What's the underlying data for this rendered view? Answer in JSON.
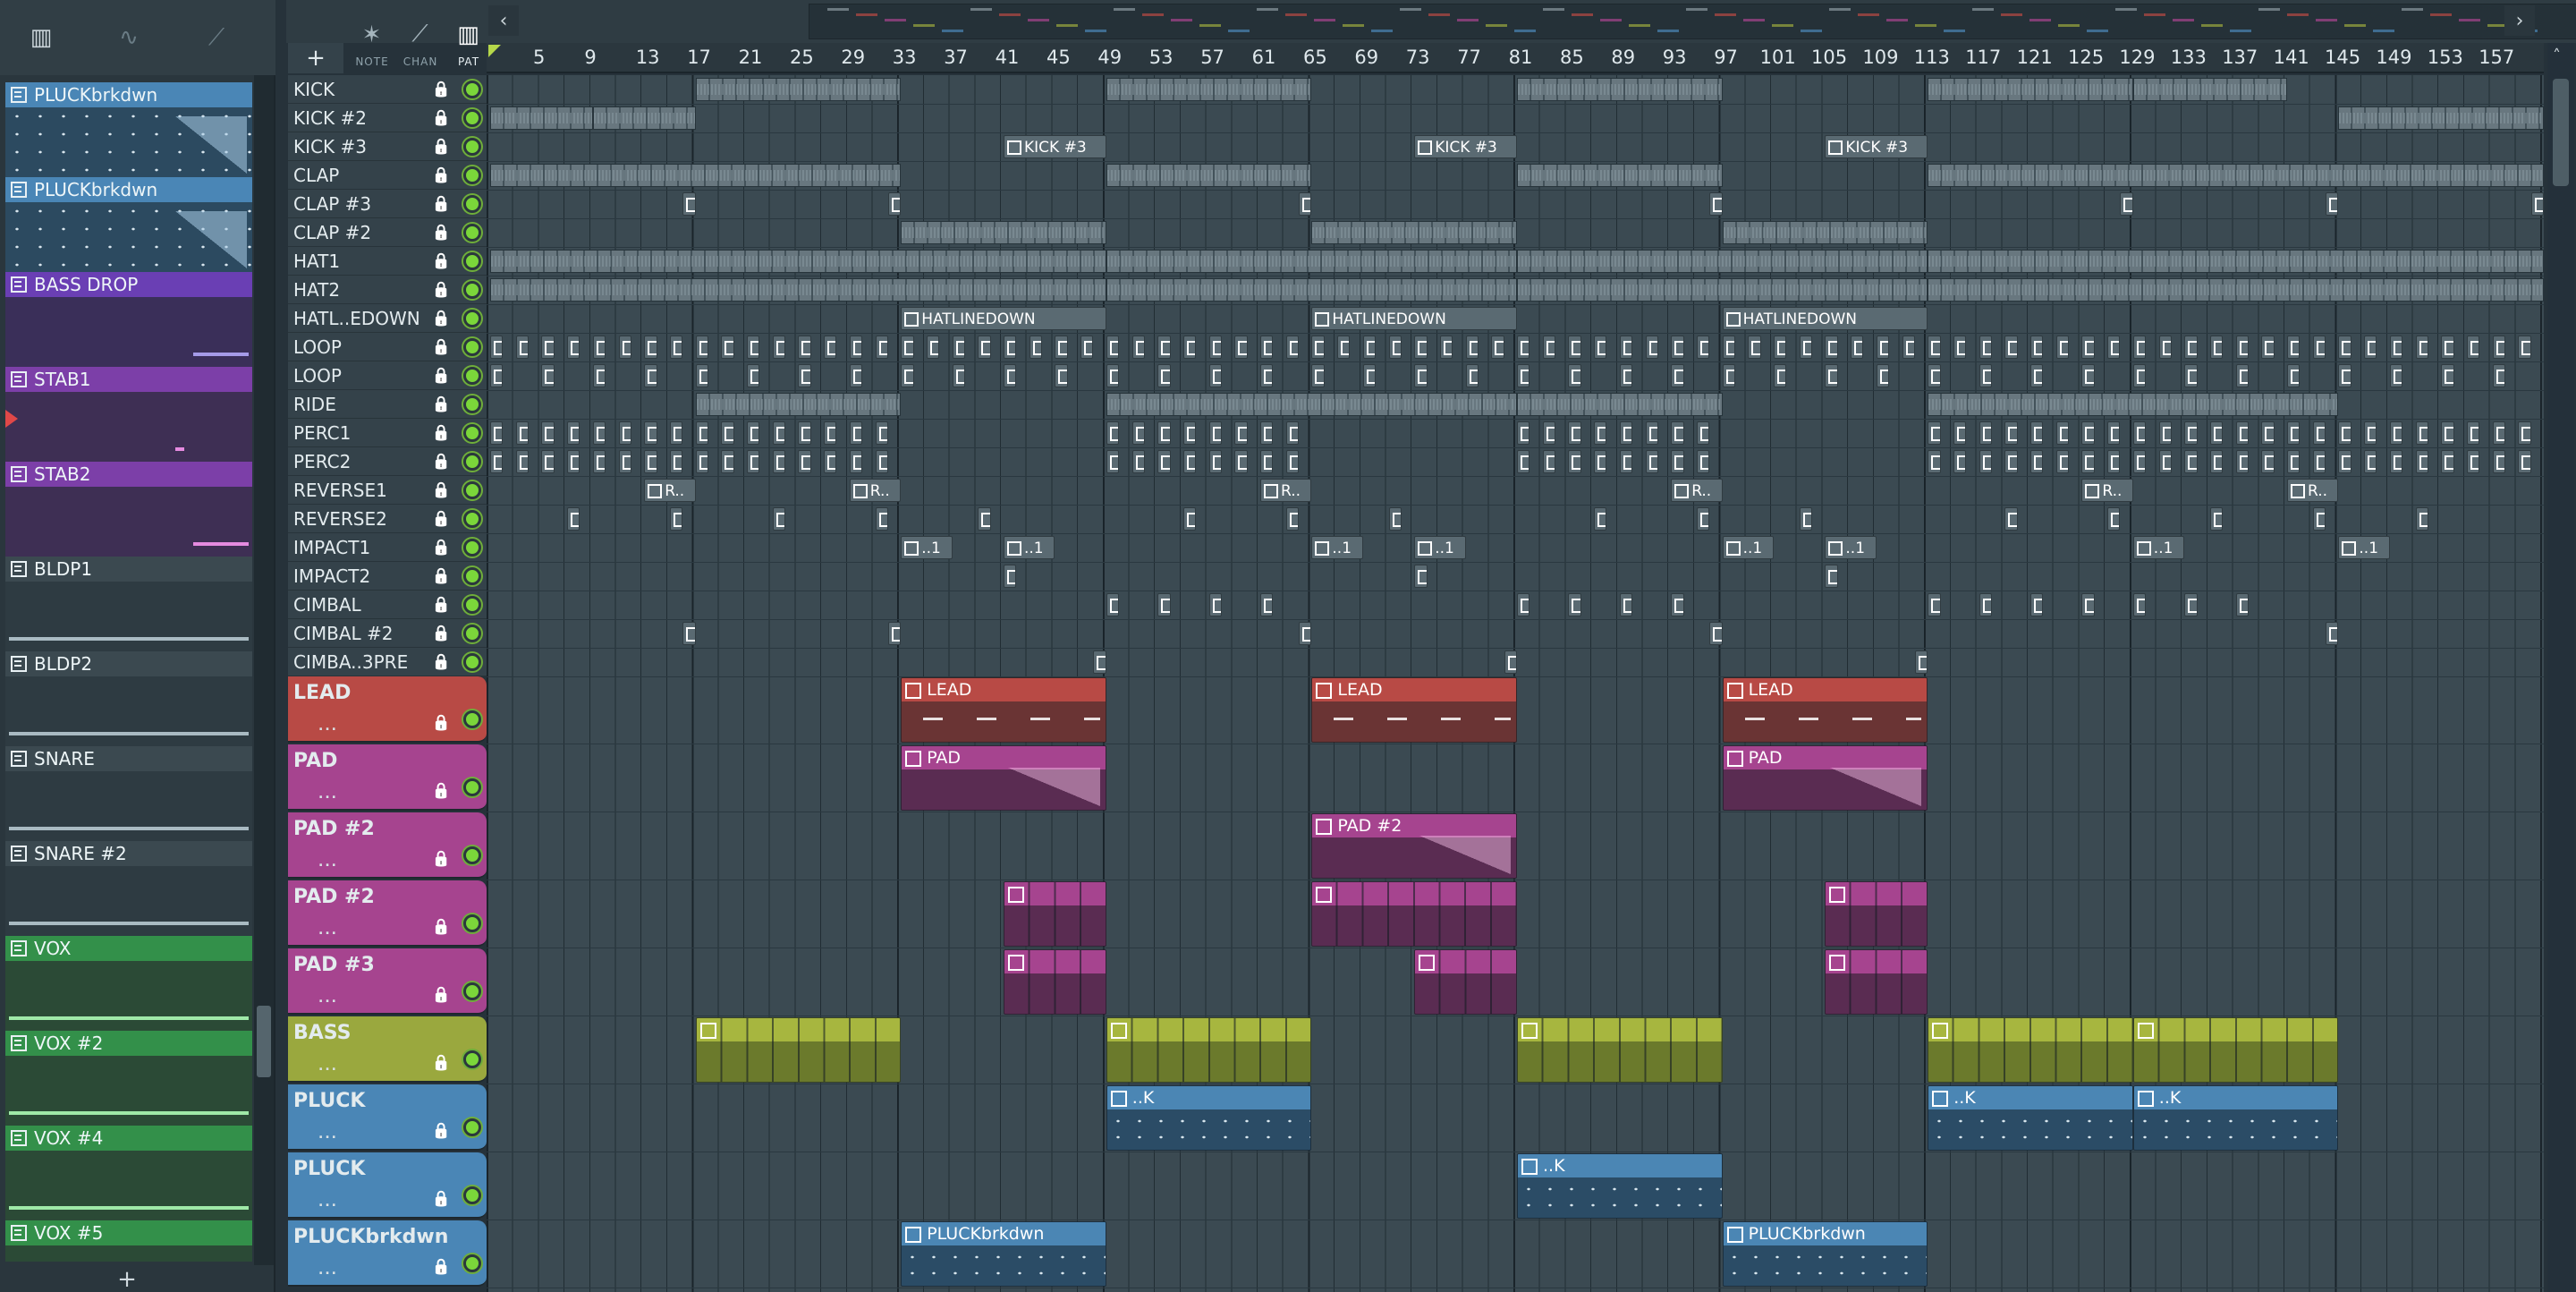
{
  "picker": {
    "toolbar_icons": [
      "piano-icon",
      "waveform-icon",
      "automation-icon"
    ],
    "items": [
      {
        "name": "PLUCKbrkdwn",
        "color": "#4a86b6",
        "body": "#2c4a60",
        "line": ""
      },
      {
        "name": "PLUCKbrkdwn",
        "color": "#4a86b6",
        "body": "#2c4a60",
        "line": ""
      },
      {
        "name": "BASS DROP",
        "color": "#6a3fb4",
        "body": "#3a2f59",
        "line": "#a59be8"
      },
      {
        "name": "STAB1",
        "color": "#7c3fa8",
        "body": "#3e2f54",
        "line": "#e58be0"
      },
      {
        "name": "STAB2",
        "color": "#7c3fa8",
        "body": "#3e2f54",
        "line": "#e58be0"
      },
      {
        "name": "BLDP1",
        "color": "#3b4950",
        "body": "#2e3b42",
        "line": "#a9bac2"
      },
      {
        "name": "BLDP2",
        "color": "#3b4950",
        "body": "#2e3b42",
        "line": "#a9bac2"
      },
      {
        "name": "SNARE",
        "color": "#3b4950",
        "body": "#2e3b42",
        "line": "#a9bac2"
      },
      {
        "name": "SNARE #2",
        "color": "#3b4950",
        "body": "#2e3b42",
        "line": "#a9bac2"
      },
      {
        "name": "VOX",
        "color": "#33904a",
        "body": "#2b4a36",
        "line": "#9fe9a8"
      },
      {
        "name": "VOX #2",
        "color": "#33904a",
        "body": "#2b4a36",
        "line": "#9fe9a8"
      },
      {
        "name": "VOX #4",
        "color": "#33904a",
        "body": "#2b4a36",
        "line": "#9fe9a8"
      },
      {
        "name": "VOX #5",
        "color": "#33904a",
        "body": "#2b4a36",
        "line": "#9fe9a8"
      }
    ],
    "add_label": "+"
  },
  "toolbar": {
    "add_label": "+",
    "modes": [
      {
        "label": "NOTE",
        "icon": "note-icon",
        "active": false
      },
      {
        "label": "CHAN",
        "icon": "channel-icon",
        "active": false
      },
      {
        "label": "PAT",
        "icon": "pattern-icon",
        "active": true
      }
    ],
    "left_arrow": "‹",
    "right_arrow": "›"
  },
  "ruler": {
    "bars": [
      "5",
      "9",
      "13",
      "17",
      "21",
      "25",
      "29",
      "33",
      "37",
      "41",
      "45",
      "49",
      "53",
      "57",
      "61",
      "65",
      "69",
      "73",
      "77",
      "81",
      "85",
      "89",
      "93",
      "97",
      "101",
      "105",
      "109",
      "113",
      "117",
      "121",
      "125",
      "129",
      "133",
      "137",
      "141",
      "145",
      "149",
      "153",
      "157"
    ]
  },
  "tracks": [
    {
      "name": "KICK",
      "size": "small",
      "color": ""
    },
    {
      "name": "KICK #2",
      "size": "small",
      "color": ""
    },
    {
      "name": "KICK #3",
      "size": "small",
      "color": ""
    },
    {
      "name": "CLAP",
      "size": "small",
      "color": ""
    },
    {
      "name": "CLAP #3",
      "size": "small",
      "color": ""
    },
    {
      "name": "CLAP #2",
      "size": "small",
      "color": ""
    },
    {
      "name": "HAT1",
      "size": "small",
      "color": ""
    },
    {
      "name": "HAT2",
      "size": "small",
      "color": ""
    },
    {
      "name": "HATL..EDOWN",
      "size": "small",
      "color": ""
    },
    {
      "name": "LOOP",
      "size": "small",
      "color": ""
    },
    {
      "name": "LOOP",
      "size": "small",
      "color": ""
    },
    {
      "name": "RIDE",
      "size": "small",
      "color": ""
    },
    {
      "name": "PERC1",
      "size": "small",
      "color": ""
    },
    {
      "name": "PERC2",
      "size": "small",
      "color": ""
    },
    {
      "name": "REVERSE1",
      "size": "small",
      "color": ""
    },
    {
      "name": "REVERSE2",
      "size": "small",
      "color": ""
    },
    {
      "name": "IMPACT1",
      "size": "small",
      "color": ""
    },
    {
      "name": "IMPACT2",
      "size": "small",
      "color": ""
    },
    {
      "name": "CIMBAL",
      "size": "small",
      "color": ""
    },
    {
      "name": "CIMBAL #2",
      "size": "small",
      "color": ""
    },
    {
      "name": "CIMBA..3PRE",
      "size": "small",
      "color": ""
    },
    {
      "name": "LEAD",
      "size": "big",
      "color": "#b84a45"
    },
    {
      "name": "PAD",
      "size": "big",
      "color": "#a6448f"
    },
    {
      "name": "PAD #2",
      "size": "big",
      "color": "#a6448f"
    },
    {
      "name": "PAD #2",
      "size": "big",
      "color": "#a6448f"
    },
    {
      "name": "PAD #3",
      "size": "big",
      "color": "#a6448f"
    },
    {
      "name": "BASS",
      "size": "big",
      "color": "#9aa83e"
    },
    {
      "name": "PLUCK",
      "size": "big",
      "color": "#4a86b6"
    },
    {
      "name": "PLUCK",
      "size": "big",
      "color": "#4a86b6"
    },
    {
      "name": "PLUCKbrkdwn",
      "size": "big",
      "color": "#4a86b6"
    }
  ],
  "clips": {
    "kick3": "KICK #3",
    "hatline": "HATLINEDOWN",
    "lead": "LEAD",
    "pad": "PAD",
    "pad2": "PAD #2",
    "pluckbrk": "PLUCKbrkdwn",
    "rev": "R..",
    "impact": "..1",
    "pluck_short": "..K"
  },
  "colors": {
    "lead_body": "#6a3434",
    "pad_body": "#5a2c52",
    "bass_body": "#6b7a2c",
    "bass_head": "#a7b63f",
    "pluck_body": "#2b4c66",
    "pluck_head": "#4b86b4"
  }
}
